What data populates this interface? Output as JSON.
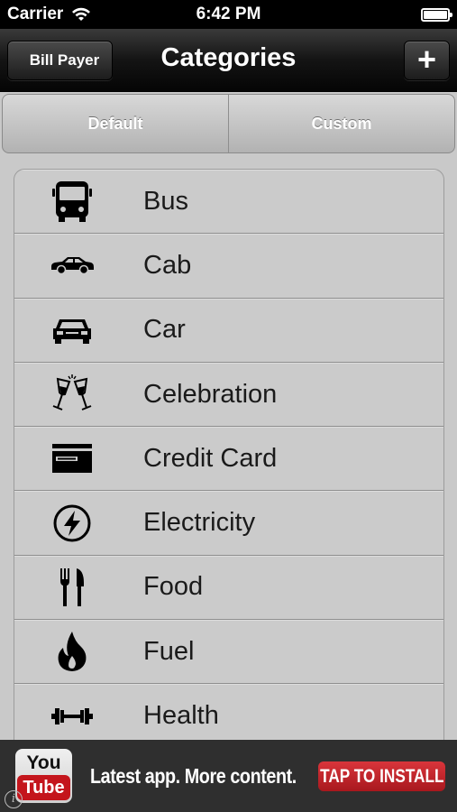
{
  "status_bar": {
    "carrier": "Carrier",
    "time": "6:42 PM",
    "icons": [
      "wifi-icon",
      "battery-icon"
    ]
  },
  "nav": {
    "back_label": "Bill Payer",
    "title": "Categories",
    "add_label": "+"
  },
  "segments": [
    {
      "label": "Default",
      "selected": true
    },
    {
      "label": "Custom",
      "selected": false
    }
  ],
  "categories": [
    {
      "label": "Bus",
      "icon": "bus-icon"
    },
    {
      "label": "Cab",
      "icon": "cab-icon"
    },
    {
      "label": "Car",
      "icon": "car-icon"
    },
    {
      "label": "Celebration",
      "icon": "champagne-glasses-icon"
    },
    {
      "label": "Credit Card",
      "icon": "credit-card-icon"
    },
    {
      "label": "Electricity",
      "icon": "lightning-bolt-icon"
    },
    {
      "label": "Food",
      "icon": "fork-knife-icon"
    },
    {
      "label": "Fuel",
      "icon": "flame-icon"
    },
    {
      "label": "Health",
      "icon": "dumbbell-icon"
    }
  ],
  "ad": {
    "logo_top": "You",
    "logo_bottom": "Tube",
    "text": "Latest app. More content.",
    "cta": "TAP TO INSTALL",
    "info": "i"
  },
  "colors": {
    "nav_background": "#141414",
    "list_background": "#cbcbcb",
    "ad_background": "#2f2f2f",
    "cta_red": "#c4151c"
  }
}
